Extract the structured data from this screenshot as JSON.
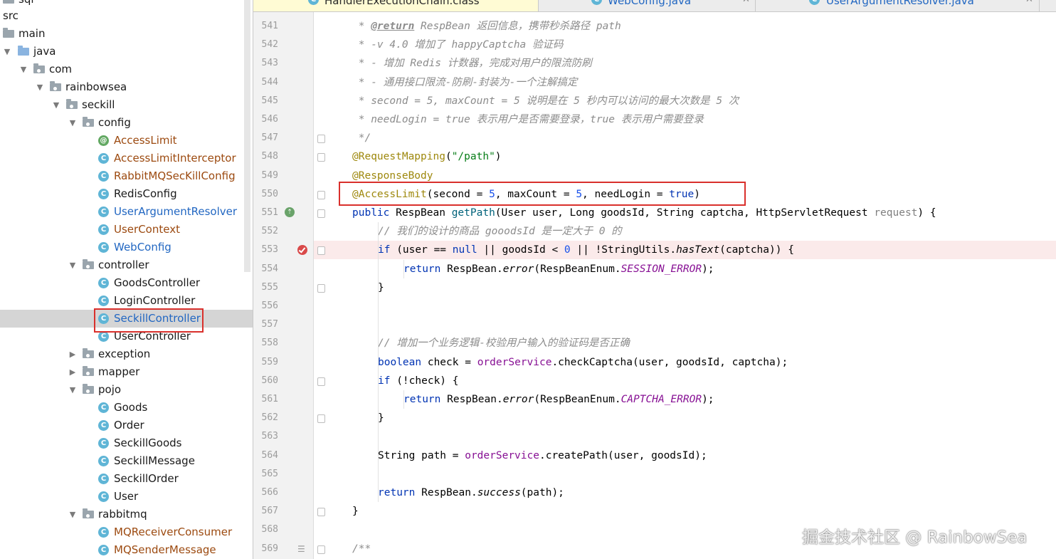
{
  "tree": {
    "items": [
      {
        "label": "sql",
        "kind": "folder",
        "depth": 0,
        "arrow": "",
        "style": "java"
      },
      {
        "label": "src",
        "kind": "none",
        "depth": 0,
        "arrow": "",
        "style": "java"
      },
      {
        "label": "main",
        "kind": "folder",
        "depth": 0,
        "arrow": "",
        "style": "java"
      },
      {
        "label": "java",
        "kind": "src-folder",
        "depth": 0,
        "arrow": "down",
        "style": "java"
      },
      {
        "label": "com",
        "kind": "package",
        "depth": 1,
        "arrow": "down",
        "style": "java"
      },
      {
        "label": "rainbowsea",
        "kind": "package",
        "depth": 2,
        "arrow": "down",
        "style": "java"
      },
      {
        "label": "seckill",
        "kind": "package",
        "depth": 3,
        "arrow": "down",
        "style": "java"
      },
      {
        "label": "config",
        "kind": "package",
        "depth": 4,
        "arrow": "down",
        "style": "java"
      },
      {
        "label": "AccessLimit",
        "kind": "annotation",
        "depth": 5,
        "arrow": "",
        "style": "mod"
      },
      {
        "label": "AccessLimitInterceptor",
        "kind": "class",
        "depth": 5,
        "arrow": "",
        "style": "mod"
      },
      {
        "label": "RabbitMQSecKillConfig",
        "kind": "class",
        "depth": 5,
        "arrow": "",
        "style": "mod"
      },
      {
        "label": "RedisConfig",
        "kind": "class",
        "depth": 5,
        "arrow": "",
        "style": "java"
      },
      {
        "label": "UserArgumentResolver",
        "kind": "class",
        "depth": 5,
        "arrow": "",
        "style": "new"
      },
      {
        "label": "UserContext",
        "kind": "class",
        "depth": 5,
        "arrow": "",
        "style": "mod"
      },
      {
        "label": "WebConfig",
        "kind": "class",
        "depth": 5,
        "arrow": "",
        "style": "new"
      },
      {
        "label": "controller",
        "kind": "package",
        "depth": 4,
        "arrow": "down",
        "style": "java"
      },
      {
        "label": "GoodsController",
        "kind": "class",
        "depth": 5,
        "arrow": "",
        "style": "java"
      },
      {
        "label": "LoginController",
        "kind": "class",
        "depth": 5,
        "arrow": "",
        "style": "java"
      },
      {
        "label": "SeckillController",
        "kind": "class",
        "depth": 5,
        "arrow": "",
        "style": "new",
        "selected": true
      },
      {
        "label": "UserController",
        "kind": "class",
        "depth": 5,
        "arrow": "",
        "style": "java"
      },
      {
        "label": "exception",
        "kind": "package",
        "depth": 4,
        "arrow": "right",
        "style": "java"
      },
      {
        "label": "mapper",
        "kind": "package",
        "depth": 4,
        "arrow": "right",
        "style": "java"
      },
      {
        "label": "pojo",
        "kind": "package",
        "depth": 4,
        "arrow": "down",
        "style": "java"
      },
      {
        "label": "Goods",
        "kind": "class",
        "depth": 5,
        "arrow": "",
        "style": "java"
      },
      {
        "label": "Order",
        "kind": "class",
        "depth": 5,
        "arrow": "",
        "style": "java"
      },
      {
        "label": "SeckillGoods",
        "kind": "class",
        "depth": 5,
        "arrow": "",
        "style": "java"
      },
      {
        "label": "SeckillMessage",
        "kind": "class",
        "depth": 5,
        "arrow": "",
        "style": "java"
      },
      {
        "label": "SeckillOrder",
        "kind": "class",
        "depth": 5,
        "arrow": "",
        "style": "java"
      },
      {
        "label": "User",
        "kind": "class",
        "depth": 5,
        "arrow": "",
        "style": "java"
      },
      {
        "label": "rabbitmq",
        "kind": "package",
        "depth": 4,
        "arrow": "down",
        "style": "java"
      },
      {
        "label": "MQReceiverConsumer",
        "kind": "class",
        "depth": 5,
        "arrow": "",
        "style": "mod"
      },
      {
        "label": "MQSenderMessage",
        "kind": "class",
        "depth": 5,
        "arrow": "",
        "style": "mod"
      }
    ]
  },
  "tabs": [
    {
      "label": "HandlerExecutionChain.class",
      "style": "plain",
      "active": true
    },
    {
      "label": "WebConfig.java",
      "style": "mod",
      "active": false
    },
    {
      "label": "UserArgumentResolver.java",
      "style": "mod",
      "active": false
    }
  ],
  "colors": {
    "comment": "#8c8c8c",
    "keyword": "#0033b3",
    "annotation": "#9e880d",
    "string": "#067d17",
    "number": "#1750eb",
    "field": "#871094",
    "method": "#00627a",
    "param": "#808080",
    "highlight": "#d9302c"
  },
  "code": {
    "lines": [
      {
        "n": "541",
        "indent": 1,
        "bp": false,
        "tokens": [
          [
            "c",
            " * "
          ],
          [
            "cb",
            "@return"
          ],
          [
            "c",
            " RespBean 返回信息，携带秒杀路径 path"
          ]
        ]
      },
      {
        "n": "542",
        "indent": 1,
        "bp": false,
        "tokens": [
          [
            "c",
            " * -v 4.0 增加了 happyCaptcha 验证码"
          ]
        ]
      },
      {
        "n": "543",
        "indent": 1,
        "bp": false,
        "tokens": [
          [
            "c",
            " * - 增加 Redis 计数器，完成对用户的限流防刷"
          ]
        ]
      },
      {
        "n": "544",
        "indent": 1,
        "bp": false,
        "tokens": [
          [
            "c",
            " * - 通用接口限流-防刷-封装为-一个注解搞定"
          ]
        ]
      },
      {
        "n": "545",
        "indent": 1,
        "bp": false,
        "tokens": [
          [
            "c",
            " * second = 5, maxCount = 5 说明是在 5 秒内可以访问的最大次数是 5 次"
          ]
        ]
      },
      {
        "n": "546",
        "indent": 1,
        "bp": false,
        "tokens": [
          [
            "c",
            " * needLogin = true 表示用户是否需要登录，true 表示用户需要登录"
          ]
        ]
      },
      {
        "n": "547",
        "indent": 1,
        "bp": false,
        "tokens": [
          [
            "c",
            " */"
          ]
        ]
      },
      {
        "n": "548",
        "indent": 1,
        "bp": false,
        "tokens": [
          [
            "a",
            "@RequestMapping"
          ],
          [
            "p",
            "("
          ],
          [
            "s",
            "\"/path\""
          ],
          [
            "p",
            ")"
          ]
        ]
      },
      {
        "n": "549",
        "indent": 1,
        "bp": false,
        "tokens": [
          [
            "a",
            "@ResponseBody"
          ]
        ]
      },
      {
        "n": "550",
        "indent": 1,
        "bp": false,
        "tokens": [
          [
            "a",
            "@AccessLimit"
          ],
          [
            "p",
            "(second = "
          ],
          [
            "num",
            "5"
          ],
          [
            "p",
            ", maxCount = "
          ],
          [
            "num",
            "5"
          ],
          [
            "p",
            ", needLogin = "
          ],
          [
            "k",
            "true"
          ],
          [
            "p",
            ")"
          ]
        ]
      },
      {
        "n": "551",
        "indent": 1,
        "bp": false,
        "tokens": [
          [
            "k",
            "public "
          ],
          [
            "p",
            "RespBean "
          ],
          [
            "m",
            "getPath"
          ],
          [
            "p",
            "(User user, Long goodsId, String captcha, HttpServletRequest "
          ],
          [
            "pa",
            "request"
          ],
          [
            "p",
            ") {"
          ]
        ]
      },
      {
        "n": "552",
        "indent": 2,
        "bp": false,
        "tokens": [
          [
            "c",
            "// 我们的设计的商品 gooodsId 是一定大于 0 的"
          ]
        ]
      },
      {
        "n": "553",
        "indent": 2,
        "bp": true,
        "tokens": [
          [
            "k",
            "if "
          ],
          [
            "p",
            "(user == "
          ],
          [
            "k",
            "null"
          ],
          [
            "p",
            " || goodsId < "
          ],
          [
            "num",
            "0"
          ],
          [
            "p",
            " || !StringUtils."
          ],
          [
            "i",
            "hasText"
          ],
          [
            "p",
            "(captcha)) {"
          ]
        ]
      },
      {
        "n": "554",
        "indent": 3,
        "bp": false,
        "tokens": [
          [
            "k",
            "return "
          ],
          [
            "p",
            "RespBean."
          ],
          [
            "i",
            "error"
          ],
          [
            "p",
            "(RespBeanEnum."
          ],
          [
            "f",
            "SESSION_ERROR"
          ],
          [
            "p",
            ");"
          ]
        ]
      },
      {
        "n": "555",
        "indent": 2,
        "bp": false,
        "tokens": [
          [
            "p",
            "}"
          ]
        ]
      },
      {
        "n": "556",
        "indent": 0,
        "bp": false,
        "tokens": []
      },
      {
        "n": "557",
        "indent": 0,
        "bp": false,
        "tokens": []
      },
      {
        "n": "558",
        "indent": 2,
        "bp": false,
        "tokens": [
          [
            "c",
            "// 增加一个业务逻辑-校验用户输入的验证码是否正确"
          ]
        ]
      },
      {
        "n": "559",
        "indent": 2,
        "bp": false,
        "tokens": [
          [
            "k",
            "boolean "
          ],
          [
            "p",
            "check = "
          ],
          [
            "fi",
            "orderService"
          ],
          [
            "p",
            ".checkCaptcha(user, goodsId, captcha);"
          ]
        ]
      },
      {
        "n": "560",
        "indent": 2,
        "bp": false,
        "tokens": [
          [
            "k",
            "if "
          ],
          [
            "p",
            "(!check) {"
          ]
        ]
      },
      {
        "n": "561",
        "indent": 3,
        "bp": false,
        "tokens": [
          [
            "k",
            "return "
          ],
          [
            "p",
            "RespBean."
          ],
          [
            "i",
            "error"
          ],
          [
            "p",
            "(RespBeanEnum."
          ],
          [
            "f",
            "CAPTCHA_ERROR"
          ],
          [
            "p",
            ");"
          ]
        ]
      },
      {
        "n": "562",
        "indent": 2,
        "bp": false,
        "tokens": [
          [
            "p",
            "}"
          ]
        ]
      },
      {
        "n": "563",
        "indent": 0,
        "bp": false,
        "tokens": []
      },
      {
        "n": "564",
        "indent": 2,
        "bp": false,
        "tokens": [
          [
            "p",
            "String path = "
          ],
          [
            "fi",
            "orderService"
          ],
          [
            "p",
            ".createPath(user, goodsId);"
          ]
        ]
      },
      {
        "n": "565",
        "indent": 0,
        "bp": false,
        "tokens": []
      },
      {
        "n": "566",
        "indent": 2,
        "bp": false,
        "tokens": [
          [
            "k",
            "return "
          ],
          [
            "p",
            "RespBean."
          ],
          [
            "i",
            "success"
          ],
          [
            "p",
            "(path);"
          ]
        ]
      },
      {
        "n": "567",
        "indent": 1,
        "bp": false,
        "tokens": [
          [
            "p",
            "}"
          ]
        ]
      },
      {
        "n": "568",
        "indent": 0,
        "bp": false,
        "tokens": []
      },
      {
        "n": "569",
        "indent": 1,
        "bp": false,
        "tokens": [
          [
            "c",
            "/**"
          ]
        ]
      }
    ]
  },
  "watermark": "掘金技术社区 @ RainbowSea"
}
